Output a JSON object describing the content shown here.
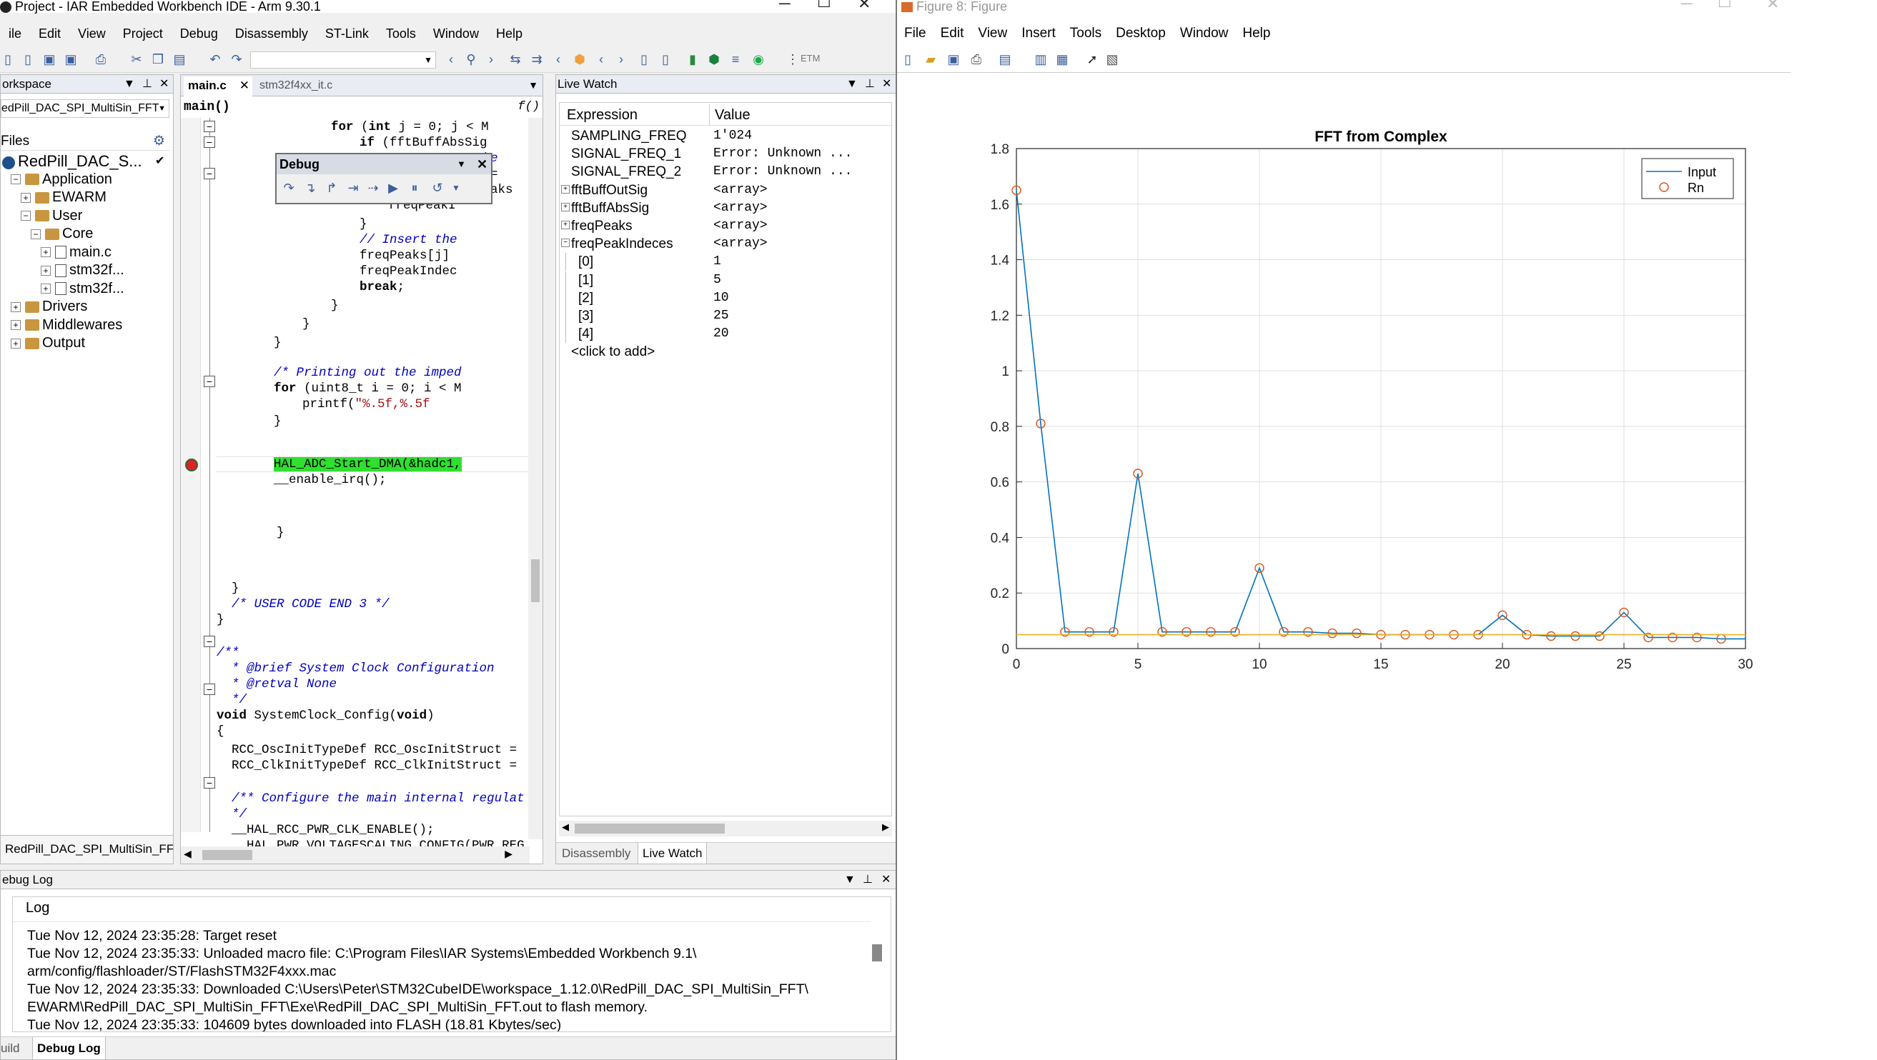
{
  "iar": {
    "title": "Project - IAR Embedded Workbench IDE - Arm 9.30.1",
    "menu": [
      "ile",
      "Edit",
      "View",
      "Project",
      "Debug",
      "Disassembly",
      "ST-Link",
      "Tools",
      "Window",
      "Help"
    ],
    "toolbar_etm": "ETM",
    "workspace": {
      "header": "orkspace",
      "config": "edPill_DAC_SPI_MultiSin_FFT",
      "files_label": "Files",
      "tree": [
        {
          "label": "RedPill_DAC_S...",
          "level": 0,
          "type": "project",
          "check": "✔"
        },
        {
          "label": "Application",
          "level": 1,
          "type": "folder",
          "exp": "−"
        },
        {
          "label": "EWARM",
          "level": 2,
          "type": "folder",
          "exp": "+"
        },
        {
          "label": "User",
          "level": 2,
          "type": "folder",
          "exp": "−"
        },
        {
          "label": "Core",
          "level": 3,
          "type": "folder",
          "exp": "−"
        },
        {
          "label": "main.c",
          "level": 4,
          "type": "file",
          "exp": "+"
        },
        {
          "label": "stm32f...",
          "level": 4,
          "type": "file",
          "exp": "+"
        },
        {
          "label": "stm32f...",
          "level": 4,
          "type": "file",
          "exp": "+"
        },
        {
          "label": "Drivers",
          "level": 1,
          "type": "folder",
          "exp": "+"
        },
        {
          "label": "Middlewares",
          "level": 1,
          "type": "folder",
          "exp": "+"
        },
        {
          "label": "Output",
          "level": 1,
          "type": "folder",
          "exp": "+"
        }
      ],
      "footer_tab": "RedPill_DAC_SPI_MultiSin_FF"
    },
    "editor": {
      "tabs": [
        "main.c",
        "stm32f4xx_it.c"
      ],
      "function": "main()",
      "fx": "f()",
      "debug_toolbar_title": "Debug"
    },
    "livewatch": {
      "header": "Live Watch",
      "col_expression": "Expression",
      "col_value": "Value",
      "rows": [
        {
          "expr": "SAMPLING_FREQ",
          "value": "1'024",
          "exp": "",
          "indent": 0
        },
        {
          "expr": "SIGNAL_FREQ_1",
          "value": "Error: Unknown ...",
          "exp": "",
          "indent": 0
        },
        {
          "expr": "SIGNAL_FREQ_2",
          "value": "Error: Unknown ...",
          "exp": "",
          "indent": 0
        },
        {
          "expr": "fftBuffOutSig",
          "value": "<array>",
          "exp": "+",
          "indent": 0
        },
        {
          "expr": "fftBuffAbsSig",
          "value": "<array>",
          "exp": "+",
          "indent": 0
        },
        {
          "expr": "freqPeaks",
          "value": "<array>",
          "exp": "+",
          "indent": 0
        },
        {
          "expr": "freqPeakIndeces",
          "value": "<array>",
          "exp": "−",
          "indent": 0
        },
        {
          "expr": "[0]",
          "value": "1",
          "exp": "",
          "indent": 1
        },
        {
          "expr": "[1]",
          "value": "5",
          "exp": "",
          "indent": 1
        },
        {
          "expr": "[2]",
          "value": "10",
          "exp": "",
          "indent": 1
        },
        {
          "expr": "[3]",
          "value": "25",
          "exp": "",
          "indent": 1
        },
        {
          "expr": "[4]",
          "value": "20",
          "exp": "",
          "indent": 1
        },
        {
          "expr": "<click to add>",
          "value": "",
          "exp": "",
          "indent": 0
        }
      ],
      "tabs": [
        "Disassembly",
        "Live Watch"
      ]
    },
    "log": {
      "header": "ebug Log",
      "col": "Log",
      "lines": [
        "Tue Nov 12, 2024 23:35:28: Target reset",
        "Tue Nov 12, 2024 23:35:33: Unloaded macro file: C:\\Program Files\\IAR Systems\\Embedded Workbench 9.1\\",
        "arm/config/flashloader/ST/FlashSTM32F4xxx.mac",
        "Tue Nov 12, 2024 23:35:33: Downloaded C:\\Users\\Peter\\STM32CubeIDE\\workspace_1.12.0\\RedPill_DAC_SPI_MultiSin_FFT\\",
        "EWARM\\RedPill_DAC_SPI_MultiSin_FFT\\Exe\\RedPill_DAC_SPI_MultiSin_FFT.out to flash memory.",
        "Tue Nov 12, 2024 23:35:33: 104609 bytes downloaded into FLASH (18.81 Kbytes/sec)"
      ],
      "tabs": [
        "uild",
        "Debug Log"
      ]
    }
  },
  "figure": {
    "title": "Figure 8: Figure",
    "menu": [
      "File",
      "Edit",
      "View",
      "Insert",
      "Tools",
      "Desktop",
      "Window",
      "Help"
    ]
  },
  "colors": {
    "accent": "#0072bd",
    "marker": "#d95319",
    "threshold": "#edb120",
    "highlight": "#2fe02f"
  },
  "chart_data": {
    "type": "line",
    "title": "FFT from Complex",
    "xlabel": "",
    "ylabel": "",
    "xlim": [
      0,
      30
    ],
    "ylim": [
      0,
      1.8
    ],
    "xticks": [
      0,
      5,
      10,
      15,
      20,
      25,
      30
    ],
    "yticks": [
      0,
      0.2,
      0.4,
      0.6,
      0.8,
      1,
      1.2,
      1.4,
      1.6,
      1.8
    ],
    "grid": true,
    "legend": "top-right",
    "x": [
      0,
      1,
      2,
      3,
      4,
      5,
      6,
      7,
      8,
      9,
      10,
      11,
      12,
      13,
      14,
      15,
      16,
      17,
      18,
      19,
      20,
      21,
      22,
      23,
      24,
      25,
      26,
      27,
      28,
      29,
      30
    ],
    "series": [
      {
        "name": "Input",
        "style": "line",
        "values": [
          1.65,
          0.81,
          0.06,
          0.06,
          0.06,
          0.63,
          0.06,
          0.06,
          0.06,
          0.06,
          0.29,
          0.06,
          0.06,
          0.055,
          0.055,
          0.05,
          0.05,
          0.05,
          0.05,
          0.05,
          0.12,
          0.05,
          0.045,
          0.045,
          0.045,
          0.13,
          0.04,
          0.04,
          0.04,
          0.035,
          0.035
        ]
      },
      {
        "name": "Rn",
        "style": "markers",
        "values": [
          1.65,
          0.81,
          0.06,
          0.06,
          0.06,
          0.63,
          0.06,
          0.06,
          0.06,
          0.06,
          0.29,
          0.06,
          0.06,
          0.055,
          0.055,
          0.05,
          0.05,
          0.05,
          0.05,
          0.05,
          0.12,
          0.05,
          0.045,
          0.045,
          0.045,
          0.13,
          0.04,
          0.04,
          0.04,
          0.035
        ]
      },
      {
        "name": "",
        "style": "hline",
        "values": [
          0.05
        ]
      }
    ]
  }
}
